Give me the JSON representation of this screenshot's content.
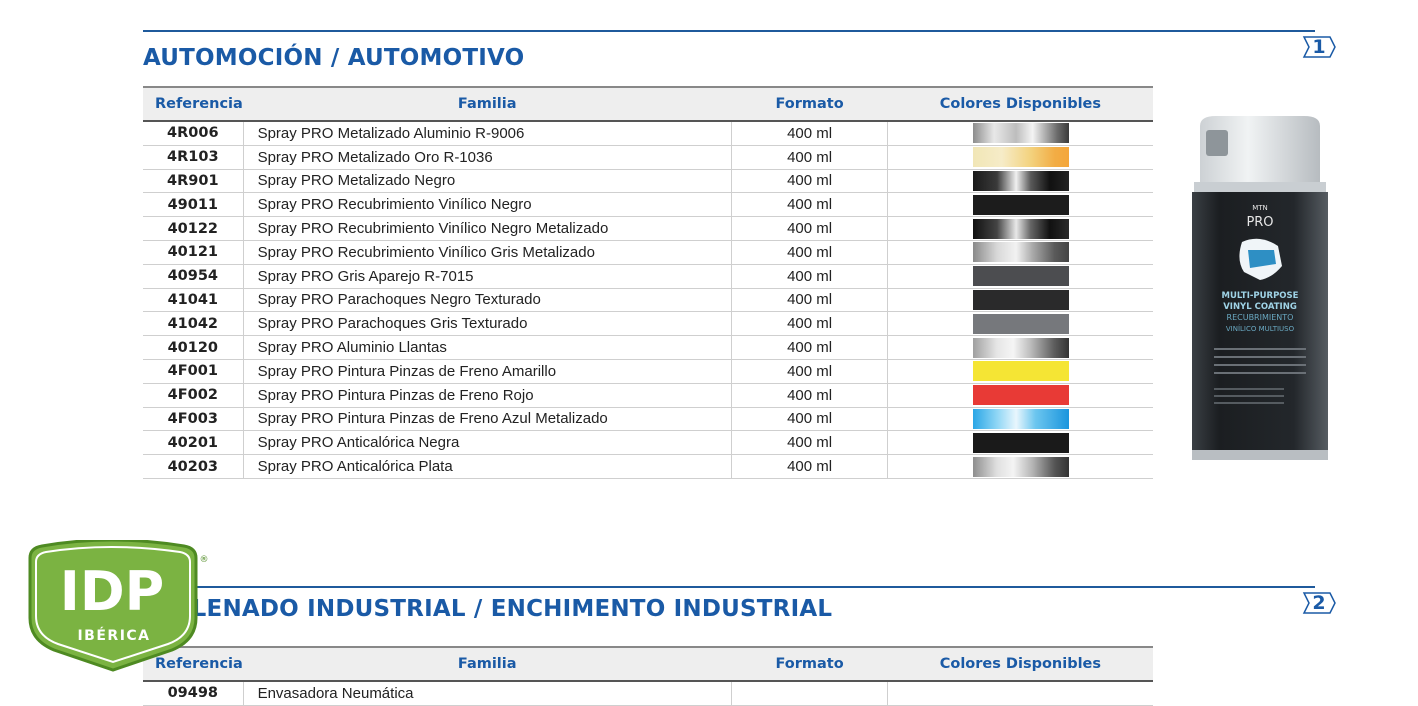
{
  "section1": {
    "title": "AUTOMOCIÓN / AUTOMOTIVO",
    "number": "1",
    "headers": {
      "ref": "Referencia",
      "familia": "Familia",
      "formato": "Formato",
      "colores": "Colores Disponibles"
    },
    "rows": [
      {
        "ref": "4R006",
        "familia": "Spray PRO Metalizado Aluminio R-9006",
        "formato": "400 ml",
        "swatch": "linear-gradient(90deg,#8d8d8d 0%,#e8e8e8 22%,#bdbdbd 45%,#f4f4f4 62%,#6a6a6a 88%,#3a3a3a 100%)"
      },
      {
        "ref": "4R103",
        "familia": "Spray PRO Metalizado Oro R-1036",
        "formato": "400 ml",
        "swatch": "linear-gradient(90deg,#f1e6b6 0%,#f6ecc8 30%,#f3d27e 60%,#f2ad45 85%,#f4a63a 100%)"
      },
      {
        "ref": "4R901",
        "familia": "Spray PRO Metalizado Negro",
        "formato": "400 ml",
        "swatch": "linear-gradient(90deg,#1a1a1a 0%,#3a3a3a 25%,#f0f0f0 45%,#5a5a5a 60%,#111 80%,#222 100%)"
      },
      {
        "ref": "49011",
        "familia": "Spray PRO Recubrimiento Vinílico Negro",
        "formato": "400 ml",
        "swatch": "#1c1c1c"
      },
      {
        "ref": "40122",
        "familia": "Spray PRO Recubrimiento Vinílico Negro Metalizado",
        "formato": "400 ml",
        "swatch": "linear-gradient(90deg,#111 0%,#444 25%,#e8e8e8 45%,#666 60%,#111 80%,#2a2a2a 100%)"
      },
      {
        "ref": "40121",
        "familia": "Spray PRO Recubrimiento Vinílico Gris Metalizado",
        "formato": "400 ml",
        "swatch": "linear-gradient(90deg,#8a8a8a 0%,#d8d8d8 25%,#f2f2f2 45%,#aaaaaa 62%,#5a5a5a 85%,#444 100%)"
      },
      {
        "ref": "40954",
        "familia": "Spray PRO Gris Aparejo R-7015",
        "formato": "400 ml",
        "swatch": "#4c4d50"
      },
      {
        "ref": "41041",
        "familia": "Spray PRO Parachoques Negro Texturado",
        "formato": "400 ml",
        "swatch": "#2a2a2b"
      },
      {
        "ref": "41042",
        "familia": "Spray PRO Parachoques Gris Texturado",
        "formato": "400 ml",
        "swatch": "#76787c"
      },
      {
        "ref": "40120",
        "familia": "Spray PRO Aluminio Llantas",
        "formato": "400 ml",
        "swatch": "linear-gradient(90deg,#a0a0a0 0%,#e6e6e6 25%,#f5f5f5 42%,#bcbcbc 60%,#5c5c5c 85%,#333 100%)"
      },
      {
        "ref": "4F001",
        "familia": "Spray PRO Pintura Pinzas de Freno Amarillo",
        "formato": "400 ml",
        "swatch": "#f5e534"
      },
      {
        "ref": "4F002",
        "familia": "Spray PRO Pintura Pinzas de Freno Rojo",
        "formato": "400 ml",
        "swatch": "#e83a36"
      },
      {
        "ref": "4F003",
        "familia": "Spray PRO Pintura Pinzas de Freno Azul Metalizado",
        "formato": "400 ml",
        "swatch": "linear-gradient(90deg,#2aa6e6 0%,#8fd6f5 25%,#e8f6fd 45%,#6cc6ef 65%,#1b95dd 100%)"
      },
      {
        "ref": "40201",
        "familia": "Spray PRO Anticalórica Negra",
        "formato": "400 ml",
        "swatch": "#1a1a1a"
      },
      {
        "ref": "40203",
        "familia": "Spray PRO Anticalórica Plata",
        "formato": "400 ml",
        "swatch": "linear-gradient(90deg,#8e8e8e 0%,#e0e0e0 25%,#f4f4f4 42%,#b4b4b4 62%,#555 85%,#333 100%)"
      }
    ]
  },
  "section2": {
    "title": "RELLENADO INDUSTRIAL / ENCHIMENTO INDUSTRIAL",
    "number": "2",
    "headers": {
      "ref": "Referencia",
      "familia": "Familia",
      "formato": "Formato",
      "colores": "Colores Disponibles"
    },
    "rows": [
      {
        "ref": "09498",
        "familia": "Envasadora Neumática",
        "formato": "",
        "swatch": ""
      }
    ]
  },
  "can": {
    "brand": "MTN",
    "product": "PRO",
    "lines": [
      "MULTI-PURPOSE",
      "VINYL COATING",
      "RECUBRIMIENTO",
      "VINÍLICO MULTIUSO"
    ],
    "colors": {
      "body": "#23272b",
      "cap": "#d8dde0",
      "text": "#9fd3e6"
    }
  },
  "logo": {
    "text": "IDP",
    "subtext": "IBÉRICA",
    "registered": "®",
    "colors": {
      "fill": "#7bb342",
      "dark": "#4e8a22"
    }
  },
  "colors": {
    "accent": "#1a5aa6",
    "rule": "#1f5a9c"
  }
}
